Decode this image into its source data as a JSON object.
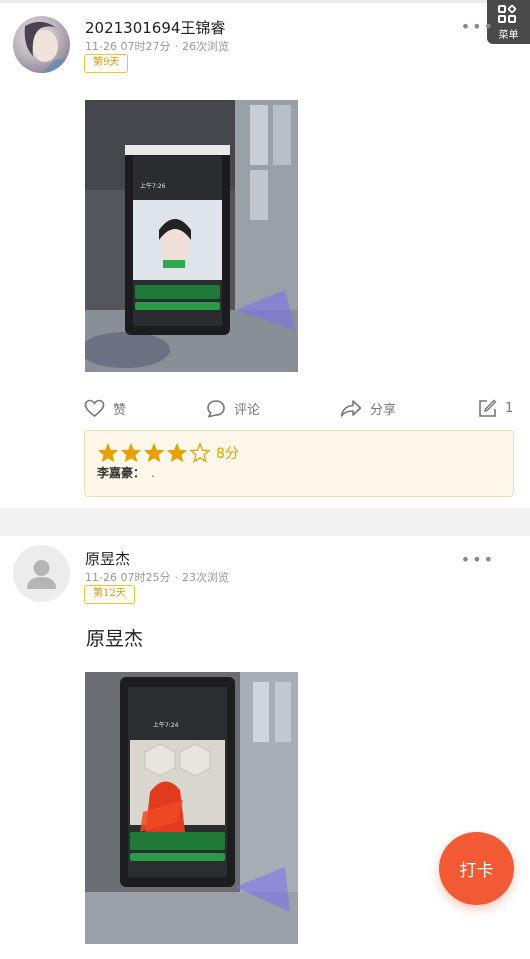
{
  "menu": {
    "label": "菜单"
  },
  "posts": [
    {
      "username": "2021301694王锦睿",
      "time": "11-26 07时27分",
      "views": "26次浏览",
      "day_badge": "第9天",
      "photo_desc": "face recognition terminal photo",
      "screen_time": "上午7:26",
      "actions": {
        "like": "赞",
        "comment": "评论",
        "share": "分享",
        "edit_count": "1"
      },
      "rating": {
        "stars": 4,
        "max_stars": 5,
        "score": "8分",
        "reviewer": "李嘉豪：",
        "review_text": "."
      }
    },
    {
      "username": "原昱杰",
      "time": "11-26 07时25分",
      "views": "23次浏览",
      "day_badge": "第12天",
      "text": "原昱杰",
      "screen_time": "上午7:24"
    }
  ],
  "fab": {
    "label": "打卡"
  },
  "colors": {
    "accent": "#f15a35",
    "badge": "#f1c232",
    "star": "#e6a100"
  }
}
